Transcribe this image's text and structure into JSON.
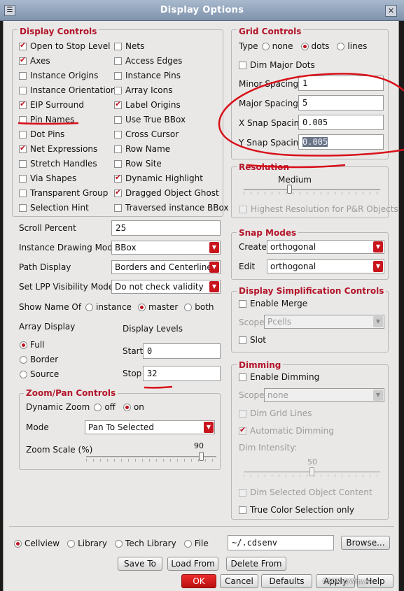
{
  "window": {
    "title": "Display Options"
  },
  "display_controls": {
    "title": "Display Controls",
    "left": [
      {
        "label": "Open to Stop Level",
        "checked": true
      },
      {
        "label": "Axes",
        "checked": true
      },
      {
        "label": "Instance Origins",
        "checked": false
      },
      {
        "label": "Instance Orientation",
        "checked": false
      },
      {
        "label": "EIP Surround",
        "checked": true
      },
      {
        "label": "Pin Names",
        "checked": false
      },
      {
        "label": "Dot Pins",
        "checked": false
      },
      {
        "label": "Net Expressions",
        "checked": true
      },
      {
        "label": "Stretch Handles",
        "checked": false
      },
      {
        "label": "Via Shapes",
        "checked": false
      },
      {
        "label": "Transparent Group",
        "checked": false
      },
      {
        "label": "Selection Hint",
        "checked": false
      }
    ],
    "right": [
      {
        "label": "Nets",
        "checked": false
      },
      {
        "label": "Access Edges",
        "checked": false
      },
      {
        "label": "Instance Pins",
        "checked": false
      },
      {
        "label": "Array Icons",
        "checked": false
      },
      {
        "label": "Label Origins",
        "checked": true
      },
      {
        "label": "Use True BBox",
        "checked": false
      },
      {
        "label": "Cross Cursor",
        "checked": false
      },
      {
        "label": "Row Name",
        "checked": false
      },
      {
        "label": "Row Site",
        "checked": false
      },
      {
        "label": "Dynamic Highlight",
        "checked": true
      },
      {
        "label": "Dragged Object Ghost",
        "checked": true
      },
      {
        "label": "Traversed instance BBox",
        "checked": false
      }
    ]
  },
  "scroll_percent": {
    "label": "Scroll Percent",
    "value": "25"
  },
  "instance_drawing_mode": {
    "label": "Instance Drawing Mode",
    "value": "BBox"
  },
  "path_display": {
    "label": "Path Display",
    "value": "Borders and Centerlines"
  },
  "set_lpp_visibility_mode": {
    "label": "Set LPP Visibility Mode",
    "value": "Do not check validity"
  },
  "show_name_of": {
    "label": "Show Name Of",
    "options": [
      "instance",
      "master",
      "both"
    ],
    "selected": "master"
  },
  "array_display": {
    "label": "Array Display",
    "options": [
      "Full",
      "Border",
      "Source"
    ],
    "selected": "Full"
  },
  "display_levels": {
    "label": "Display Levels",
    "start_label": "Start",
    "start_value": "0",
    "stop_label": "Stop",
    "stop_value": "32"
  },
  "zoom_pan": {
    "title": "Zoom/Pan Controls",
    "dynamic_zoom_label": "Dynamic Zoom",
    "dynamic_zoom_options": [
      "off",
      "on"
    ],
    "dynamic_zoom_selected": "on",
    "mode_label": "Mode",
    "mode_value": "Pan To Selected",
    "zoom_scale_label": "Zoom Scale (%)",
    "zoom_scale_value": "90",
    "zoom_scale_fraction": 0.9
  },
  "grid_controls": {
    "title": "Grid Controls",
    "type_label": "Type",
    "type_options": [
      "none",
      "dots",
      "lines"
    ],
    "type_selected": "dots",
    "dim_major_dots": {
      "label": "Dim Major Dots",
      "checked": false
    },
    "minor_spacing": {
      "label": "Minor Spacing",
      "value": "1"
    },
    "major_spacing": {
      "label": "Major Spacing",
      "value": "5"
    },
    "x_snap_spacing": {
      "label": "X Snap Spacing",
      "value": "0.005"
    },
    "y_snap_spacing": {
      "label": "Y Snap Spacing",
      "value": "0.005"
    }
  },
  "resolution": {
    "title": "Resolution",
    "value_label": "Medium",
    "level_fraction": 0.33,
    "highest_res": {
      "label": "Highest Resolution for P&R Objects",
      "checked": false
    }
  },
  "snap_modes": {
    "title": "Snap Modes",
    "create_label": "Create",
    "create_value": "orthogonal",
    "edit_label": "Edit",
    "edit_value": "orthogonal"
  },
  "display_simplification": {
    "title": "Display Simplification Controls",
    "enable_merge": {
      "label": "Enable Merge",
      "checked": false
    },
    "scope_label": "Scope",
    "scope_value": "Pcells",
    "slot": {
      "label": "Slot",
      "checked": false
    }
  },
  "dimming": {
    "title": "Dimming",
    "enable_dimming": {
      "label": "Enable Dimming",
      "checked": false
    },
    "scope_label": "Scope",
    "scope_value": "none",
    "dim_grid_lines": {
      "label": "Dim Grid Lines",
      "checked": false
    },
    "automatic_dimming": {
      "label": "Automatic Dimming",
      "checked": true
    },
    "dim_intensity_label": "Dim Intensity:",
    "dim_intensity_value": "50",
    "dim_intensity_fraction": 0.5,
    "dim_selected": {
      "label": "Dim Selected Object Content",
      "checked": false
    },
    "true_color": {
      "label": "True Color Selection only",
      "checked": false
    }
  },
  "save_target": {
    "options": [
      "Cellview",
      "Library",
      "Tech Library",
      "File"
    ],
    "selected": "Cellview",
    "file_value": "~/.cdsenv",
    "browse_label": "Browse..."
  },
  "file_buttons": {
    "save_to": "Save To",
    "load_from": "Load From",
    "delete_from": "Delete From"
  },
  "dialog_buttons": {
    "ok": "OK",
    "cancel": "Cancel",
    "defaults": "Defaults",
    "apply": "Apply",
    "help": "Help"
  },
  "watermark": "CSDN @Wfpya"
}
